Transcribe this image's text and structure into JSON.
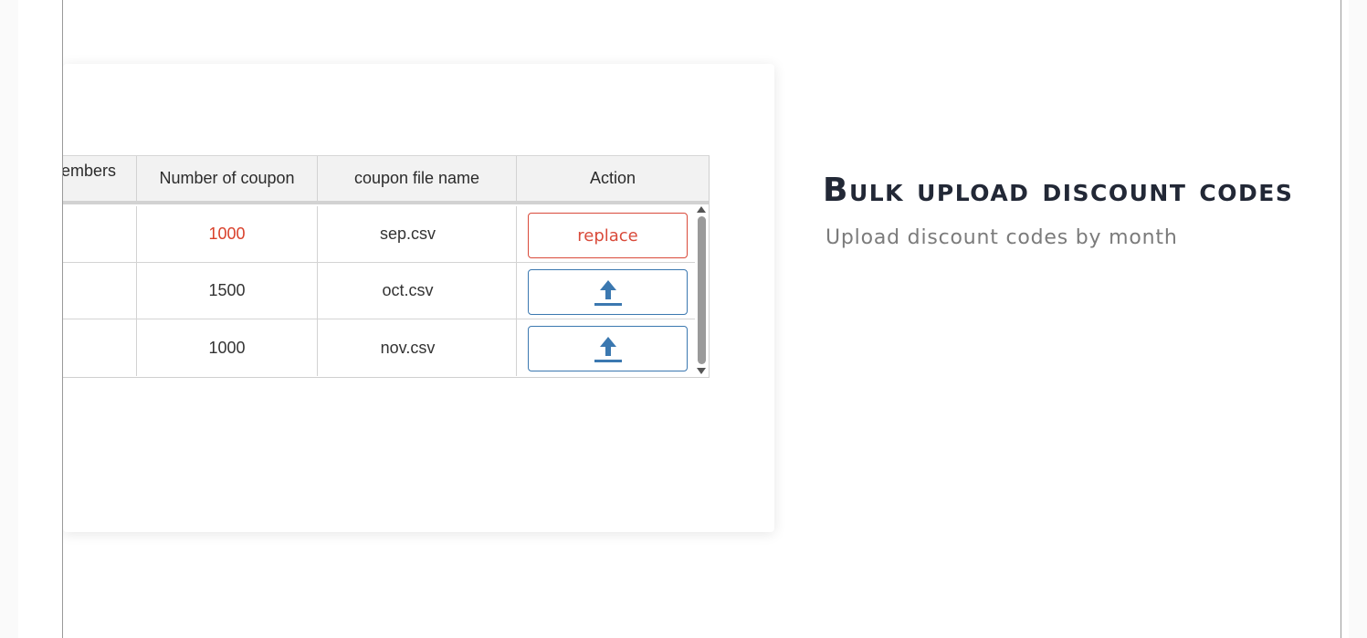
{
  "table": {
    "headers": {
      "members": "embers",
      "number": "Number of coupon",
      "file": "coupon file name",
      "action": "Action"
    },
    "rows": [
      {
        "count": "1000",
        "file": "sep.csv",
        "action": "replace",
        "highlight": true
      },
      {
        "count": "1500",
        "file": "oct.csv",
        "action": "upload",
        "highlight": false
      },
      {
        "count": "1000",
        "file": "nov.csv",
        "action": "upload",
        "highlight": false
      }
    ]
  },
  "panel": {
    "title": "Bulk upload discount codes",
    "subtitle": "Upload discount codes by month"
  },
  "icons": {
    "upload": "upload-arrow-icon"
  },
  "colors": {
    "replace": "#d94a3a",
    "upload": "#3b78b0",
    "highlight_count": "#d9402b"
  }
}
